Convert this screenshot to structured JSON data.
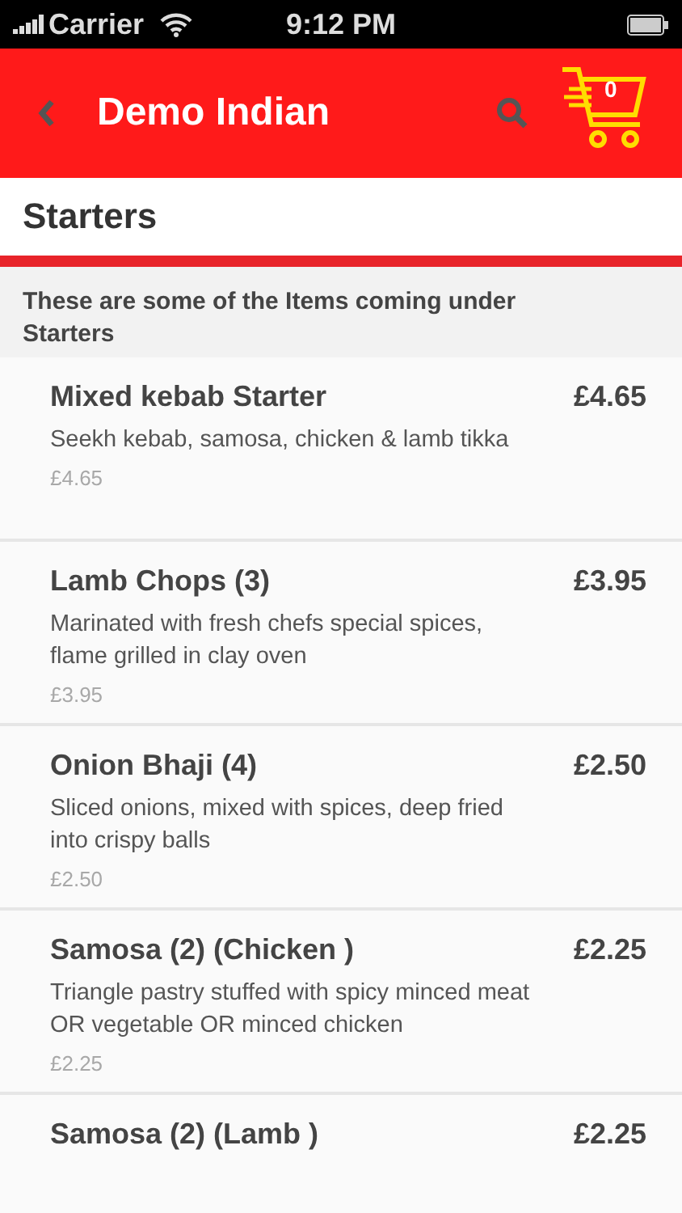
{
  "status_bar": {
    "carrier": "Carrier",
    "time": "9:12 PM"
  },
  "header": {
    "title": "Demo Indian",
    "cart_count": "0"
  },
  "section": {
    "title": "Starters",
    "intro": "These are some of the Items coming under Starters"
  },
  "items": [
    {
      "name": "Mixed kebab Starter",
      "price": "£4.65",
      "description": "Seekh kebab, samosa, chicken & lamb tikka",
      "sub_price": "£4.65"
    },
    {
      "name": "Lamb Chops (3)",
      "price": "£3.95",
      "description": "Marinated with fresh chefs special spices, flame grilled in clay oven",
      "sub_price": "£3.95"
    },
    {
      "name": "Onion Bhaji (4)",
      "price": "£2.50",
      "description": "Sliced onions, mixed with spices, deep fried into crispy balls",
      "sub_price": "£2.50"
    },
    {
      "name": "Samosa (2) (Chicken )",
      "price": "£2.25",
      "description": "Triangle pastry stuffed with spicy minced meat OR vegetable OR minced chicken",
      "sub_price": "£2.25"
    },
    {
      "name": "Samosa (2) (Lamb )",
      "price": "£2.25"
    }
  ]
}
